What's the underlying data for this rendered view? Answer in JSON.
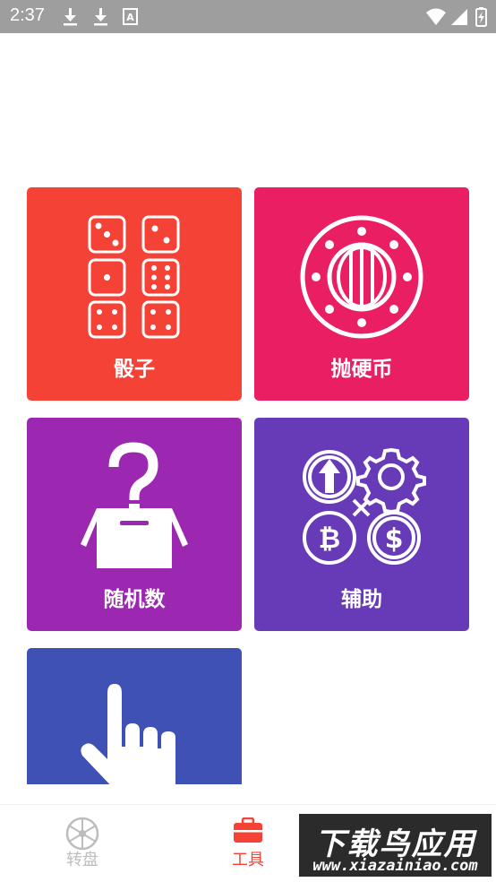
{
  "status_bar": {
    "time": "2:37",
    "left_icons": [
      "download-icon",
      "download-icon",
      "text-icon"
    ],
    "right_icons": [
      "wifi-icon",
      "signal-icon",
      "battery-charging-icon"
    ]
  },
  "tiles": [
    {
      "label": "骰子",
      "color": "#f44336",
      "icon": "dice-icon"
    },
    {
      "label": "抛硬币",
      "color": "#e91e63",
      "icon": "coin-icon"
    },
    {
      "label": "随机数",
      "color": "#9c27b0",
      "icon": "mystery-box-icon"
    },
    {
      "label": "辅助",
      "color": "#673ab7",
      "icon": "tools-crypto-icon"
    },
    {
      "label": "",
      "color": "#3f51b5",
      "icon": "tap-hand-icon"
    }
  ],
  "bottom_nav": {
    "items": [
      {
        "label": "转盘",
        "icon": "wheel-icon",
        "active": false
      },
      {
        "label": "工具",
        "icon": "toolbox-icon",
        "active": true
      }
    ],
    "active_color": "#f44336",
    "inactive_color": "#bdbdbd"
  },
  "watermark": {
    "title": "下载鸟应用",
    "url": "www.xiazainiao.com"
  }
}
